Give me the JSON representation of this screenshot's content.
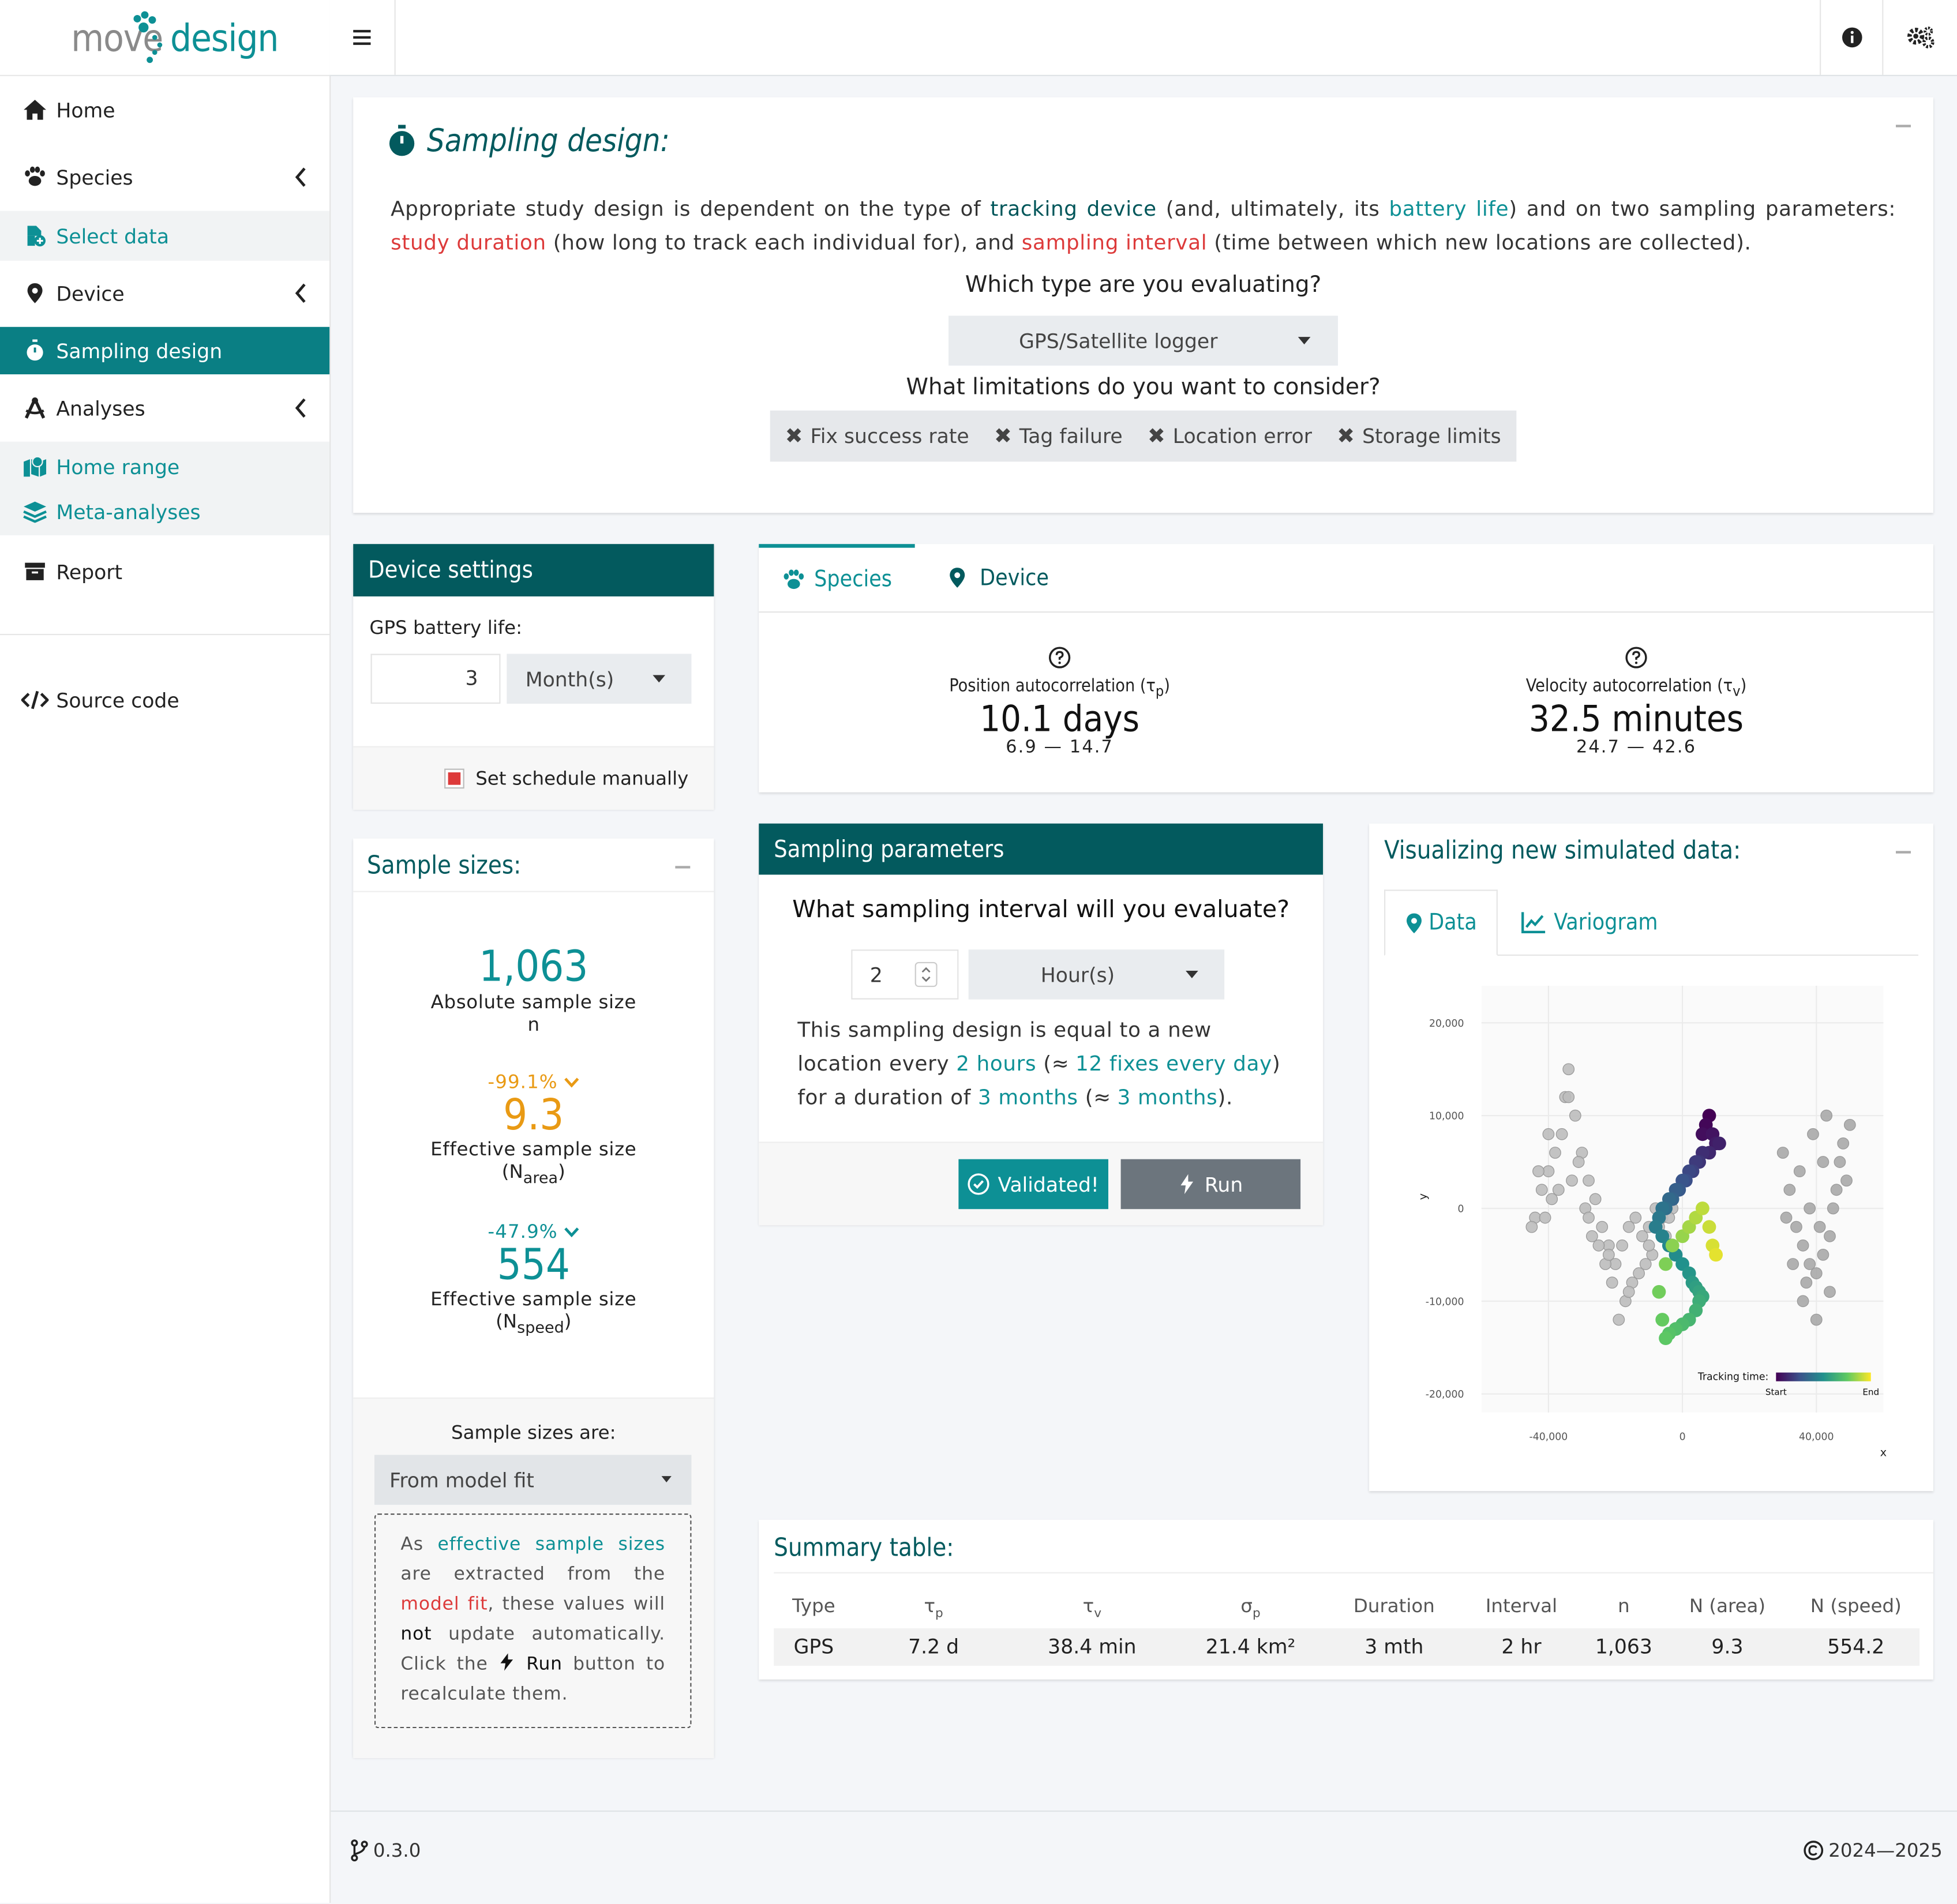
{
  "app": {
    "logo_left": "move",
    "logo_right": "design"
  },
  "sidebar": {
    "items": [
      {
        "label": "Home",
        "icon": "home-icon"
      },
      {
        "label": "Species",
        "icon": "paw-icon"
      },
      {
        "label": "Select data",
        "icon": "file-add-icon"
      },
      {
        "label": "Device",
        "icon": "map-marker-icon"
      },
      {
        "label": "Sampling design",
        "icon": "stopwatch-icon"
      },
      {
        "label": "Analyses",
        "icon": "drafting-compass-icon"
      },
      {
        "label": "Home range",
        "icon": "map-icon"
      },
      {
        "label": "Meta-analyses",
        "icon": "layers-icon"
      },
      {
        "label": "Report",
        "icon": "archive-icon"
      },
      {
        "label": "Source code",
        "icon": "code-icon"
      }
    ]
  },
  "intro": {
    "title": "Sampling design:",
    "p1": "Appropriate study design is dependent on the type of",
    "tracking_device": "tracking device",
    "p2": "(and, ultimately, its",
    "battery_life": "battery life",
    "p3": ") and on two sampling parameters:",
    "study_duration": "study duration",
    "p4": "(how long to track each individual for), and",
    "sampling_interval": "sampling interval",
    "p5": "(time between which new locations are collected).",
    "type_question": "Which type are you evaluating?",
    "type_value": "GPS/Satellite logger",
    "limits_question": "What limitations do you want to consider?",
    "limits": [
      "Fix success rate",
      "Tag failure",
      "Location error",
      "Storage limits"
    ]
  },
  "device_settings": {
    "title": "Device settings",
    "battery_label": "GPS battery life:",
    "battery_value": "3",
    "battery_unit": "Month(s)",
    "manual_label": "Set schedule manually"
  },
  "tabs": {
    "species": "Species",
    "device": "Device"
  },
  "autocorr": {
    "pos_label": "Position autocorrelation (τ",
    "pos_sub": "p",
    "pos_value": "10.1 days",
    "pos_range": "6.9 — 14.7",
    "vel_label": "Velocity autocorrelation (τ",
    "vel_sub": "v",
    "vel_value": "32.5 minutes",
    "vel_range": "24.7 — 42.6"
  },
  "sample_sizes": {
    "title": "Sample sizes:",
    "abs_value": "1,063",
    "abs_label": "Absolute sample size",
    "abs_sym": "n",
    "area_change": "-99.1%",
    "area_value": "9.3",
    "area_label": "Effective sample size",
    "area_sym": "N",
    "area_sub": "area",
    "speed_change": "-47.9%",
    "speed_value": "554",
    "speed_label": "Effective sample size",
    "speed_sym": "N",
    "speed_sub": "speed",
    "source_label": "Sample sizes are:",
    "source_value": "From model fit",
    "note_1": "As",
    "note_ess": "effective sample sizes",
    "note_2": "are extracted from the",
    "note_model": "model fit",
    "note_3": ", these values will",
    "note_not": "not",
    "note_4": "update automatically. Click the",
    "note_run": "Run",
    "note_5": "button to recalculate them."
  },
  "sampling": {
    "title": "Sampling parameters",
    "question": "What sampling interval will you evaluate?",
    "interval_value": "2",
    "interval_unit": "Hour(s)",
    "desc1": "This sampling design is equal to a new location every",
    "every": "2 hours",
    "desc2": "(≈",
    "fixes": "12 fixes every day",
    "desc3": ") for a duration of",
    "duration": "3 months",
    "desc4": "(≈",
    "duration2": "3 months",
    "desc5": ").",
    "validated": "Validated!",
    "run": "Run"
  },
  "viz": {
    "title": "Visualizing new simulated data:",
    "tab_data": "Data",
    "tab_variogram": "Variogram",
    "legend_title": "Tracking time:",
    "legend_start": "Start",
    "legend_end": "End",
    "xlabel": "x",
    "ylabel": "y"
  },
  "chart_data": {
    "type": "scatter",
    "xlabel": "x",
    "ylabel": "y",
    "xlim": [
      -60000,
      60000
    ],
    "ylim": [
      -22000,
      24000
    ],
    "x_ticks": [
      "-40,000",
      "0",
      "40,000"
    ],
    "y_ticks": [
      "20,000",
      "10,000",
      "0",
      "-10,000",
      "-20,000"
    ],
    "x_tick_values": [
      -40000,
      0,
      40000
    ],
    "y_tick_values": [
      20000,
      10000,
      0,
      -10000,
      -20000
    ],
    "grid": true,
    "legend": "bottom-right",
    "series": [
      {
        "role": "reference",
        "color": "#bdbdbd",
        "x": [
          -42000,
          -40000,
          -38000,
          -36000,
          -35000,
          -34000,
          -32000,
          -30000,
          -28000,
          -26000,
          -24000,
          -22000,
          -20000,
          -18000,
          -16000,
          -14000,
          -12000,
          -10000,
          -8000,
          -6000,
          -4000,
          -44000,
          -41000,
          -39000,
          -33000,
          -29000,
          -25000,
          -21000,
          -17000,
          -13000,
          -9000,
          -5000,
          -43000,
          -37000,
          -31000,
          -27000,
          -23000,
          -19000,
          -15000,
          -11000,
          -7000,
          -3000,
          -40000,
          -34000,
          -28000,
          -22000,
          -16000,
          -10000,
          -4000,
          -45000
        ],
        "y": [
          2000,
          4000,
          6000,
          8000,
          12000,
          15000,
          10000,
          6000,
          3000,
          1000,
          -2000,
          -4000,
          -6000,
          -4000,
          -2000,
          -1000,
          -3000,
          -2000,
          0,
          -1000,
          1000,
          -1000,
          -1000,
          1000,
          3000,
          0,
          -4000,
          -8000,
          -10000,
          -7000,
          -5000,
          -3000,
          4000,
          2000,
          5000,
          -3000,
          -6000,
          -12000,
          -8000,
          -6000,
          -2000,
          0,
          8000,
          12000,
          -1000,
          -5000,
          -9000,
          -4000,
          -1000,
          -2000
        ]
      },
      {
        "role": "reference",
        "color": "#a9a9a9",
        "x": [
          30000,
          32000,
          34000,
          36000,
          38000,
          40000,
          42000,
          44000,
          46000,
          48000,
          50000,
          31000,
          35000,
          39000,
          43000,
          47000,
          33000,
          37000,
          41000,
          45000,
          49000,
          36000,
          40000,
          44000,
          38000,
          42000
        ],
        "y": [
          6000,
          2000,
          -2000,
          -4000,
          -6000,
          -7000,
          -5000,
          -3000,
          2000,
          7000,
          9000,
          -1000,
          4000,
          8000,
          10000,
          5000,
          -6000,
          -8000,
          -2000,
          0,
          3000,
          -10000,
          -12000,
          -9000,
          0,
          5000
        ]
      },
      {
        "role": "simulated",
        "color": "tracking-time gradient",
        "x": [
          8000,
          7000,
          6000,
          9000,
          10000,
          11000,
          8000,
          6000,
          5000,
          4000,
          3000,
          2000,
          1000,
          0,
          -1000,
          -2000,
          -3000,
          -4000,
          -5000,
          -6000,
          -7000,
          -8000,
          -6000,
          -4000,
          -2000,
          0,
          2000,
          3000,
          4000,
          5000,
          6000,
          5000,
          4000,
          2000,
          0,
          -2000,
          -4000,
          -5000,
          -6000,
          -7000,
          -5000,
          -3000,
          0,
          2000,
          4000,
          6000,
          8000,
          9000,
          10000
        ],
        "y": [
          10000,
          9000,
          8000,
          8000,
          7000,
          7000,
          6000,
          6000,
          5000,
          5000,
          4000,
          4000,
          3000,
          3000,
          2000,
          2000,
          1000,
          1000,
          0,
          0,
          -1000,
          -2000,
          -3000,
          -4000,
          -5000,
          -6000,
          -7000,
          -8000,
          -8500,
          -9000,
          -9500,
          -10000,
          -11000,
          -12000,
          -12500,
          -13000,
          -13500,
          -14000,
          -12000,
          -9000,
          -6000,
          -4000,
          -3000,
          -2000,
          -1000,
          0,
          -2000,
          -4000,
          -5000
        ],
        "t": [
          0.0,
          0.02,
          0.04,
          0.06,
          0.08,
          0.1,
          0.12,
          0.14,
          0.16,
          0.18,
          0.2,
          0.22,
          0.24,
          0.26,
          0.28,
          0.3,
          0.32,
          0.34,
          0.36,
          0.38,
          0.4,
          0.42,
          0.44,
          0.46,
          0.48,
          0.5,
          0.52,
          0.54,
          0.56,
          0.58,
          0.6,
          0.62,
          0.64,
          0.66,
          0.68,
          0.7,
          0.72,
          0.74,
          0.76,
          0.78,
          0.8,
          0.82,
          0.84,
          0.86,
          0.88,
          0.9,
          0.92,
          0.94,
          0.96
        ]
      }
    ]
  },
  "summary": {
    "title": "Summary table:",
    "headers": [
      "Type",
      "τp",
      "τv",
      "σp",
      "Duration",
      "Interval",
      "n",
      "N (area)",
      "N (speed)"
    ],
    "row": [
      "GPS",
      "7.2 d",
      "38.4 min",
      "21.4 km²",
      "3 mth",
      "2 hr",
      "1,063",
      "9.3",
      "554.2"
    ]
  },
  "footer": {
    "version": "0.3.0",
    "copyright": "2024—2025"
  }
}
